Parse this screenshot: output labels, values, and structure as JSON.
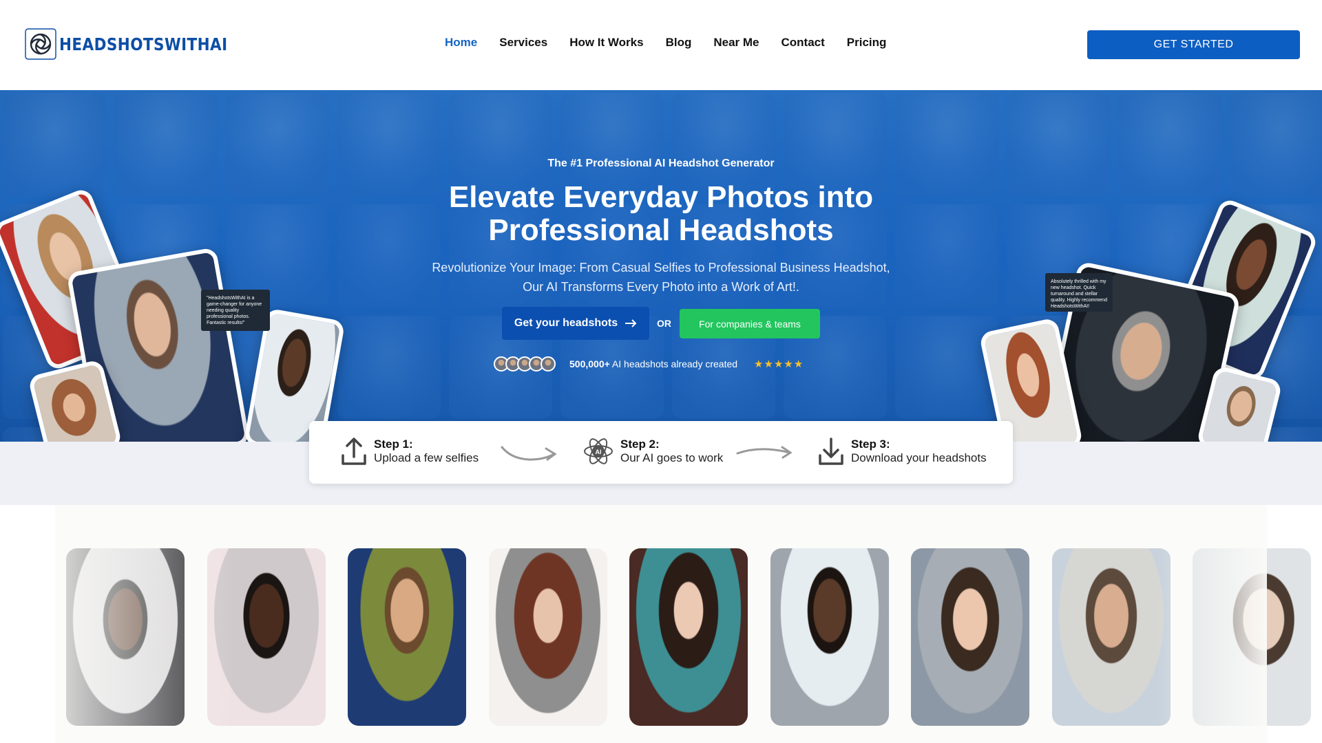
{
  "brand": {
    "name": "HEADSHOTSWITHAI",
    "color": "#0d4ea6"
  },
  "nav": {
    "items": [
      {
        "label": "Home",
        "active": true
      },
      {
        "label": "Services"
      },
      {
        "label": "How It Works"
      },
      {
        "label": "Blog"
      },
      {
        "label": "Near Me"
      },
      {
        "label": "Contact"
      },
      {
        "label": "Pricing"
      }
    ],
    "cta_label": "GET STARTED"
  },
  "hero": {
    "eyebrow": "The #1 Professional AI Headshot Generator",
    "title": "Elevate Everyday Photos into Professional Headshots",
    "subtitle": "Revolutionize Your Image: From Casual Selfies to Professional Business Headshot, Our AI Transforms Every Photo into a Work of Art!.",
    "primary_cta": "Get your headshots",
    "or_label": "OR",
    "secondary_cta": "For companies & teams",
    "social_proof": {
      "count": "500,000+",
      "text": "AI headshots already created",
      "stars": "★★★★★",
      "rating": 5
    },
    "quote_left": "\"HeadshotsWithAI is a game-changer for anyone needing quality professional photos. Fantastic results!\"",
    "quote_right": "Absolutely thrilled with my new headshot. Quick turnaround and stellar quality. Highly recommend HeadshotsWithAI!"
  },
  "steps": [
    {
      "title": "Step 1:",
      "text": "Upload a few selfies",
      "icon": "upload-icon"
    },
    {
      "title": "Step 2:",
      "text": "Our AI goes to work",
      "icon": "ai-icon"
    },
    {
      "title": "Step 3:",
      "text": "Download your headshots",
      "icon": "download-icon"
    }
  ],
  "colors": {
    "primary": "#0d5ec2",
    "green": "#22c55e",
    "hero": "#1d68c0",
    "star": "#fbbf24"
  }
}
